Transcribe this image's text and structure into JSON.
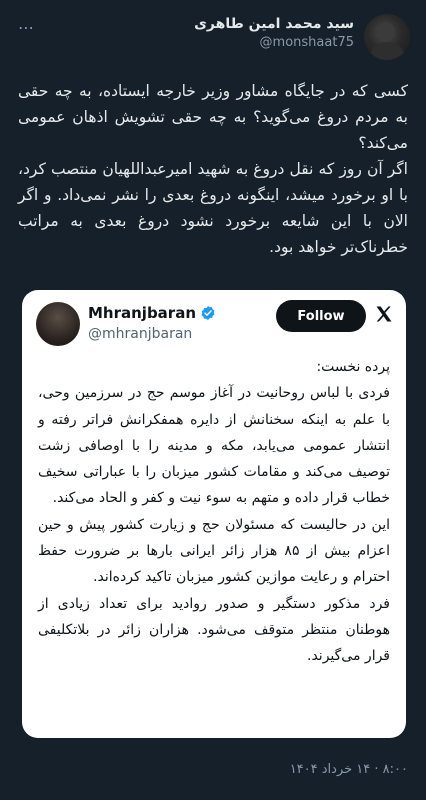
{
  "author": {
    "name": "سید محمد امین طاهری",
    "handle": "@monshaat75"
  },
  "tweet": {
    "paragraphs": [
      "کسی که در جایگاه مشاور وزیر خارجه ایستاده، به چه حقی به مردم دروغ می‌گوید؟ به چه حقی تشویش اذهان عمومی می‌کند؟",
      "اگر آن روز که نقل دروغ به شهید امیرعبداللهیان منتصب کرد، با او برخورد میشد، اینگونه دروغ بعدی را نشر نمی‌داد. و اگر الان با این شایعه برخورد نشود دروغ بعدی به مراتب خطرناک‌تر خواهد بود."
    ],
    "timestamp": "۸:۰۰ · ۱۴ خرداد ۱۴۰۴"
  },
  "embedded": {
    "name": "Mhranjbaran",
    "handle": "@mhranjbaran",
    "follow_label": "Follow",
    "paragraphs": [
      "پرده نخست:",
      "فردی با لباس روحانیت در آغاز موسم حج در سرزمین وحی، با علم به اینکه سخنانش از دایره همفکرانش فراتر رفته و انتشار عمومی می‌یابد، مکه و مدینه را با اوصافی زشت توصیف می‌کند و مقامات کشور میزبان را با عباراتی سخیف خطاب قرار داده و متهم به سوء نیت و کفر و الحاد می‌کند.",
      "این در حالیست که مسئولان حج و زیارت کشور پیش و حین اعزام بیش از ۸۵ هزار زائر ایرانی بارها بر ضرورت حفظ احترام و رعایت موازین کشور میزبان تاکید کرده‌اند.",
      "فرد مذکور دستگیر و صدور روادید برای تعداد زیادی از هوطنان منتظر متوقف می‌شود. هزاران زائر در بلاتکلیفی قرار می‌گیرند."
    ]
  },
  "icons": {
    "more": "more-dots-icon",
    "verified": "verified-badge-icon",
    "brand": "x-logo-icon"
  },
  "colors": {
    "background": "#15202b",
    "verified": "#1d9bf0",
    "follow_button": "#0f1419"
  }
}
